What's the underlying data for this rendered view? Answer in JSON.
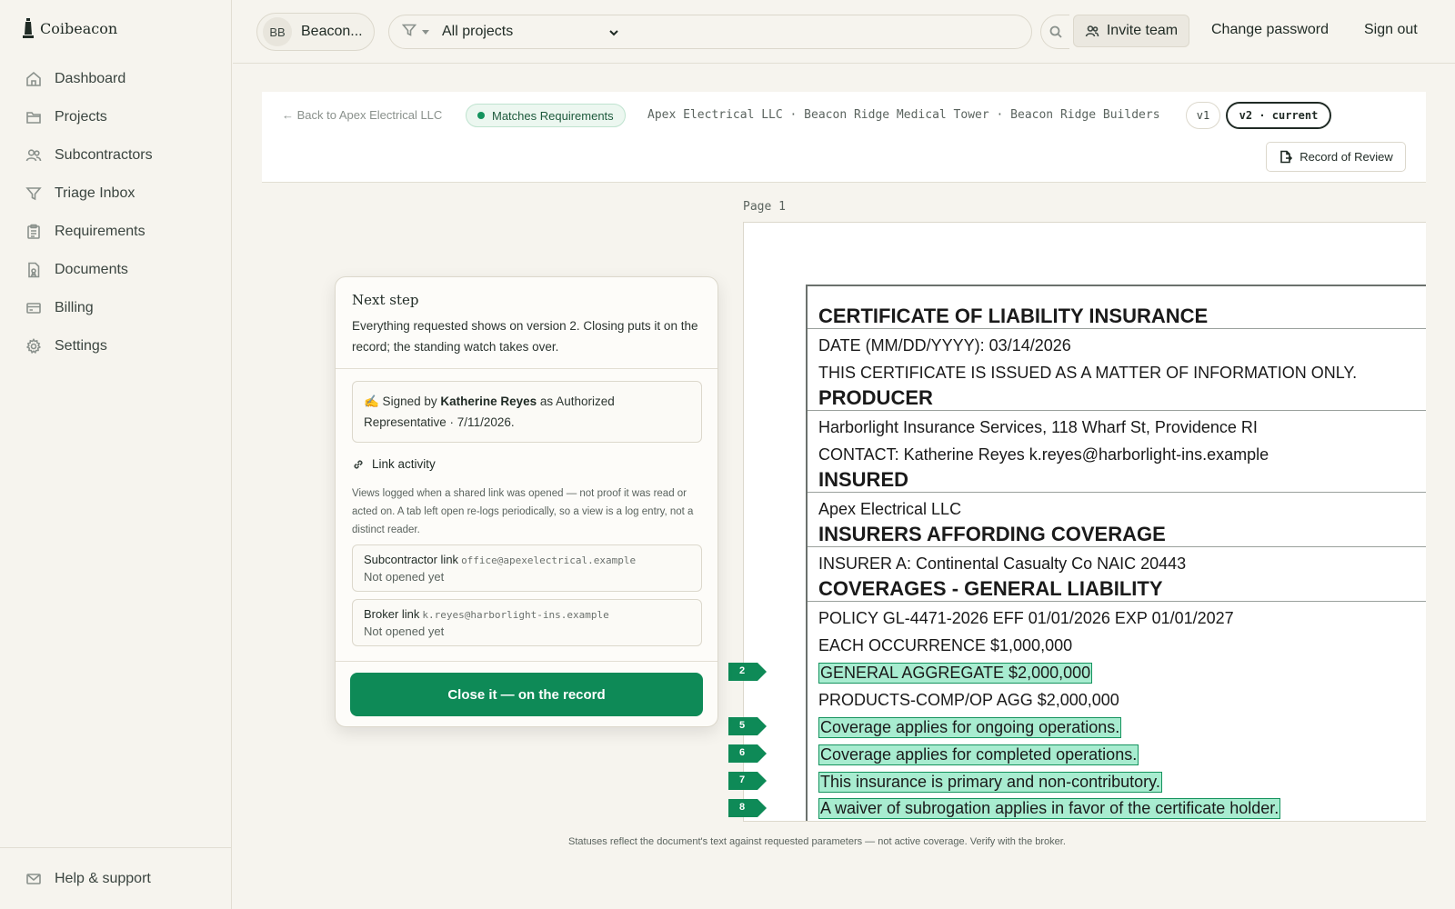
{
  "app": {
    "brand": "Coibeacon"
  },
  "sidebar": {
    "items": [
      {
        "label": "Dashboard",
        "icon": "home-icon"
      },
      {
        "label": "Projects",
        "icon": "folder-icon"
      },
      {
        "label": "Subcontractors",
        "icon": "users-icon"
      },
      {
        "label": "Triage Inbox",
        "icon": "filter-icon"
      },
      {
        "label": "Requirements",
        "icon": "clipboard-icon"
      },
      {
        "label": "Documents",
        "icon": "document-icon"
      },
      {
        "label": "Billing",
        "icon": "card-icon"
      },
      {
        "label": "Settings",
        "icon": "gear-icon"
      }
    ],
    "help": "Help & support"
  },
  "topbar": {
    "org_initials": "BB",
    "org_name": "Beacon...",
    "project_select": "All projects",
    "invite": "Invite team",
    "change_password": "Change password",
    "sign_out": "Sign out"
  },
  "doc_header": {
    "back": "← Back to Apex Electrical LLC",
    "status": "Matches Requirements",
    "crumbs": "Apex Electrical LLC · Beacon Ridge Medical Tower · Beacon Ridge Builders",
    "version_1": "v1",
    "version_2": "v2 · current",
    "record_button": "Record of Review"
  },
  "viewer": {
    "page_label": "Page 1",
    "certificate": {
      "title": "CERTIFICATE OF LIABILITY INSURANCE",
      "date": "DATE (MM/DD/YYYY): 03/14/2026",
      "notice": "THIS CERTIFICATE IS ISSUED AS A MATTER OF INFORMATION ONLY.",
      "producer_h": "PRODUCER",
      "producer": "Harborlight Insurance Services, 118 Wharf St, Providence RI",
      "contact": "CONTACT: Katherine Reyes     k.reyes@harborlight-ins.example",
      "insured_h": "INSURED",
      "insured": "Apex Electrical LLC",
      "insurers_h": "INSURERS AFFORDING COVERAGE",
      "insurer_a": "INSURER A: Continental Casualty Co     NAIC 20443",
      "coverages_h": "COVERAGES  -  GENERAL LIABILITY",
      "policy": "POLICY GL-4471-2026     EFF 01/01/2026     EXP 01/01/2027",
      "each_occ": "EACH OCCURRENCE $1,000,000",
      "gen_agg": "GENERAL AGGREGATE $2,000,000",
      "prod_agg": "PRODUCTS-COMP/OP AGG $2,000,000",
      "ongoing": "Coverage applies for ongoing operations.",
      "completed": "Coverage applies for completed operations.",
      "primary": "This insurance is primary and non-contributory.",
      "waiver": "A waiver of subrogation applies in favor of the certificate holder."
    },
    "markers": [
      "2",
      "5",
      "6",
      "7",
      "8"
    ],
    "disclaimer": "Statuses reflect the document's text against requested parameters — not active coverage. Verify with the broker."
  },
  "next_step": {
    "title": "Next step",
    "text": "Everything requested shows on version 2. Closing puts it on the record; the standing watch takes over.",
    "sig_prefix": "✍️ Signed by ",
    "sig_name": "Katherine Reyes",
    "sig_suffix": " as Authorized Representative · 7/11/2026.",
    "link_activity": "Link activity",
    "link_note": "Views logged when a shared link was opened — not proof it was read or acted on. A tab left open re-logs periodically, so a view is a log entry, not a distinct reader.",
    "links": [
      {
        "title": "Subcontractor link",
        "email": "office@apexelectrical.example",
        "status": "Not opened yet"
      },
      {
        "title": "Broker link",
        "email": "k.reyes@harborlight-ins.example",
        "status": "Not opened yet"
      }
    ],
    "close_button": "Close it — on the record"
  },
  "colors": {
    "accent": "#0e8a57",
    "highlight": "#a8ecd0",
    "background": "#f6f4ee"
  }
}
